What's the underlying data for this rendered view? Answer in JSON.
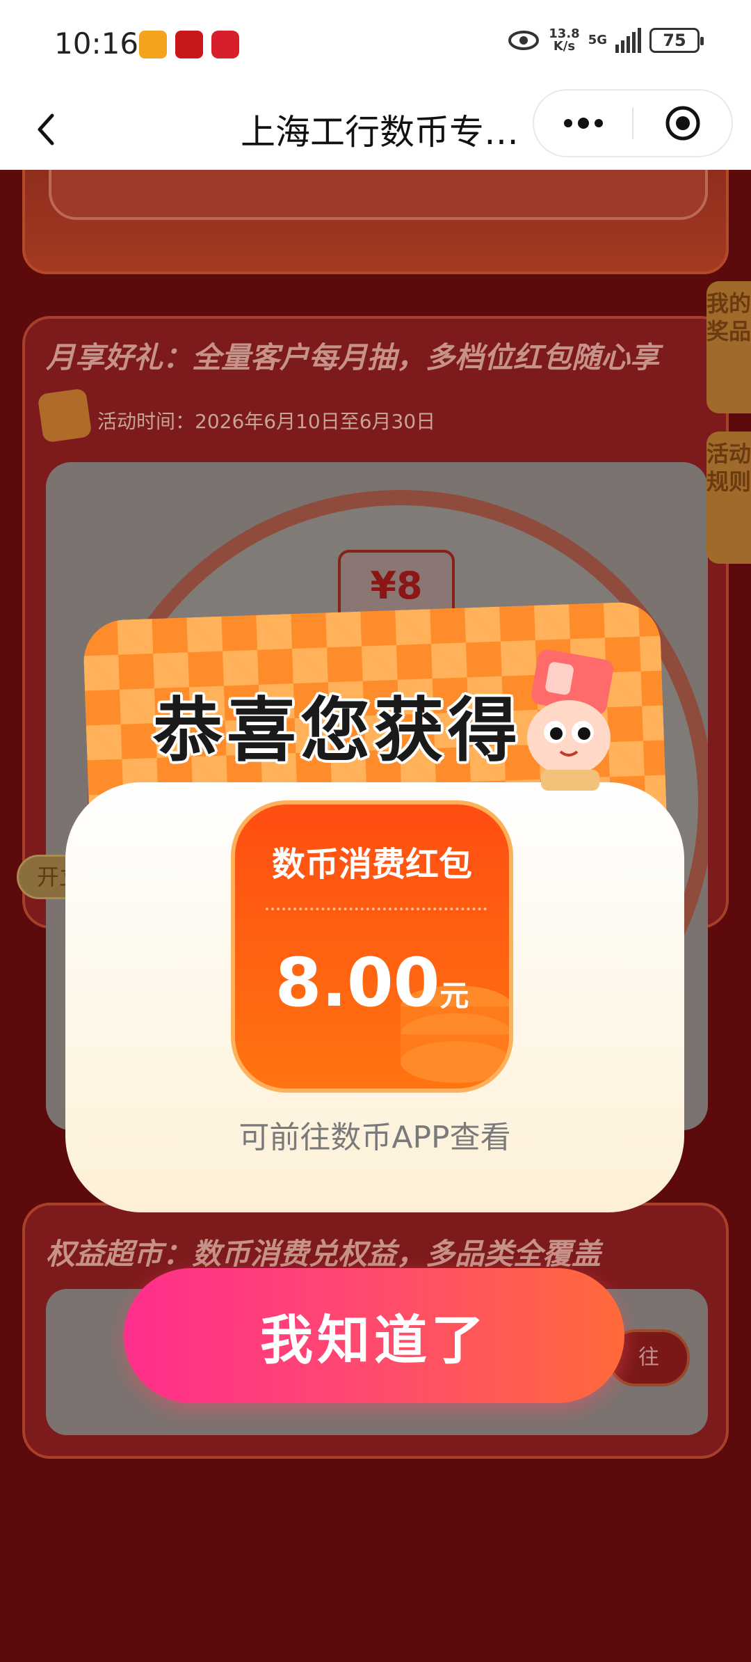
{
  "status_bar": {
    "time": "10:16",
    "net_speed": "13.8",
    "net_unit": "K/s",
    "network": "5G",
    "battery": "75"
  },
  "nav": {
    "title": "上海工行数币专…"
  },
  "background": {
    "monthly_title": "月享好礼：全量客户每月抽，多档位红包随心享",
    "activity_time": "活动时间：2026年6月10日至6月30日",
    "wheel_tag": "¥8",
    "open_button": "开立数",
    "side_tab_prizes": "我的奖品",
    "side_tab_rules": "活动规则",
    "market_title": "权益超市：数币消费兑权益，多品类全覆盖",
    "go_button": "往"
  },
  "dialog": {
    "title": "恭喜您获得",
    "coupon_name": "数币消费红包",
    "amount": "8.00",
    "unit": "元",
    "hint": "可前往数币APP查看",
    "confirm": "我知道了"
  },
  "colors": {
    "accent_orange": "#ff5a12",
    "button_pink": "#ff2f8c",
    "button_orange": "#ff6a3a"
  }
}
